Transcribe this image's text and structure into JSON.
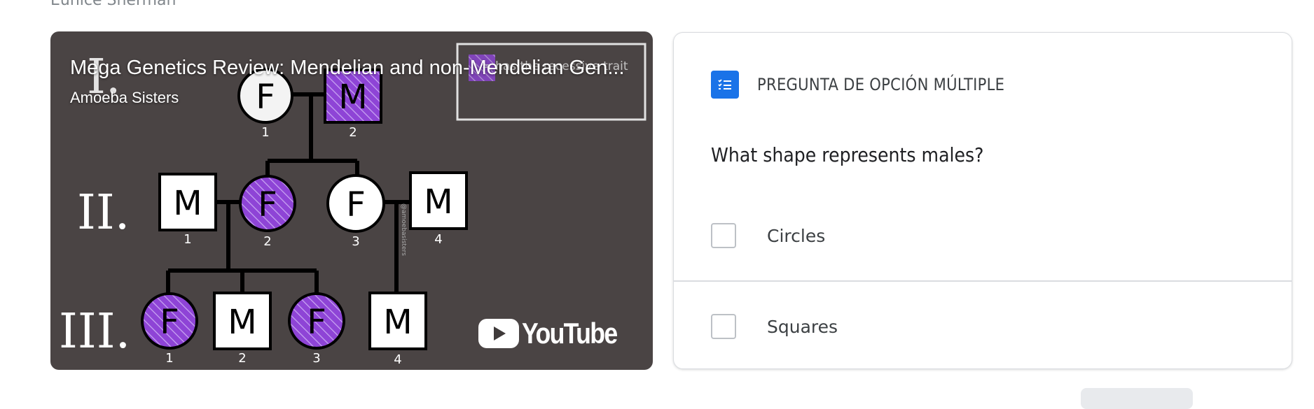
{
  "assignment": {
    "author": "Eunice Sherman"
  },
  "video": {
    "title": "Mega Genetics Review: Mendelian and non-Mendelian Gen...",
    "channel": "Amoeba Sisters",
    "platform": "YouTube",
    "thumbnail": {
      "generations": [
        "I.",
        "II.",
        "III."
      ],
      "legend_text": "= has the recessive trait",
      "watermark": "@amoebasisters",
      "gen1": [
        {
          "symbol": "F",
          "num": "1"
        },
        {
          "symbol": "M",
          "num": "2"
        }
      ],
      "gen2": [
        {
          "symbol": "M",
          "num": "1"
        },
        {
          "symbol": "F",
          "num": "2"
        },
        {
          "symbol": "F",
          "num": "3"
        },
        {
          "symbol": "M",
          "num": "4"
        }
      ],
      "gen3": [
        {
          "symbol": "F",
          "num": "1"
        },
        {
          "symbol": "M",
          "num": "2"
        },
        {
          "symbol": "F",
          "num": "3"
        },
        {
          "symbol": "M",
          "num": "4"
        }
      ],
      "affected_color": "#8e44d6"
    }
  },
  "question": {
    "type_label": "PREGUNTA DE OPCIÓN MÚLTIPLE",
    "type_icon": "checklist-icon",
    "text": "What shape represents males?",
    "options": [
      {
        "label": "Circles",
        "checked": false
      },
      {
        "label": "Squares",
        "checked": false
      }
    ]
  },
  "colors": {
    "accent": "#1a73e8",
    "video_bg": "#4a4444"
  }
}
